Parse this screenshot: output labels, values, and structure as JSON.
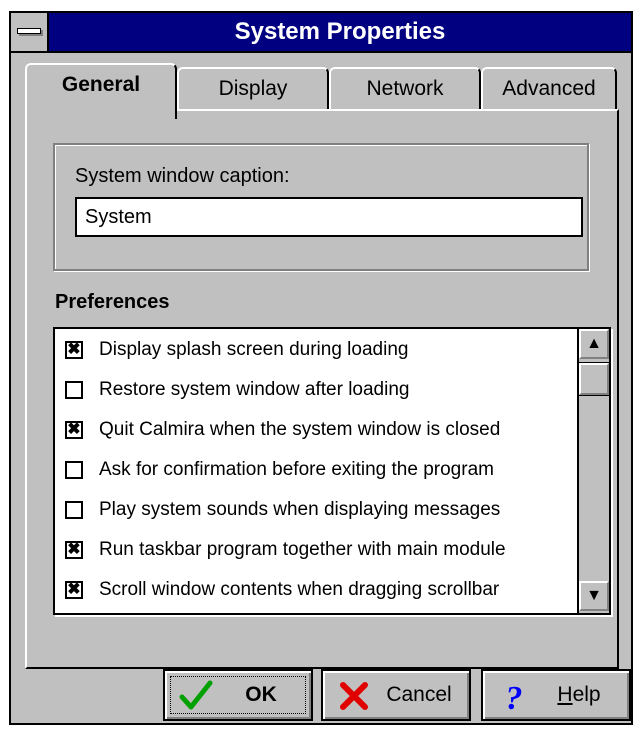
{
  "window": {
    "title": "System Properties"
  },
  "tabs": [
    {
      "label": "General",
      "active": true
    },
    {
      "label": "Display",
      "active": false
    },
    {
      "label": "Network",
      "active": false
    },
    {
      "label": "Advanced",
      "active": false
    }
  ],
  "general": {
    "caption_label": "System window caption:",
    "caption_value": "System",
    "preferences_label": "Preferences",
    "preferences": [
      {
        "label": "Display splash screen during loading",
        "checked": true
      },
      {
        "label": "Restore system window after loading",
        "checked": false
      },
      {
        "label": "Quit Calmira when the system window is closed",
        "checked": true
      },
      {
        "label": "Ask for confirmation before exiting the program",
        "checked": false
      },
      {
        "label": "Play system sounds when displaying messages",
        "checked": false
      },
      {
        "label": "Run taskbar program together with main module",
        "checked": true
      },
      {
        "label": "Scroll window contents when dragging scrollbar",
        "checked": true
      }
    ]
  },
  "buttons": {
    "ok_label": "OK",
    "cancel_label": "Cancel",
    "help_label": "Help"
  },
  "icons": {
    "sysmenu": "system-menu-icon",
    "ok": "green-checkmark-icon",
    "cancel": "red-x-icon",
    "help": "blue-question-icon",
    "scroll_up": "arrow-up-icon",
    "scroll_down": "arrow-down-icon"
  },
  "colors": {
    "titlebar": "#000080",
    "face": "#c0c0c0",
    "ok_icon": "#00a000",
    "cancel_icon": "#e00000",
    "help_icon": "#0000ff"
  }
}
